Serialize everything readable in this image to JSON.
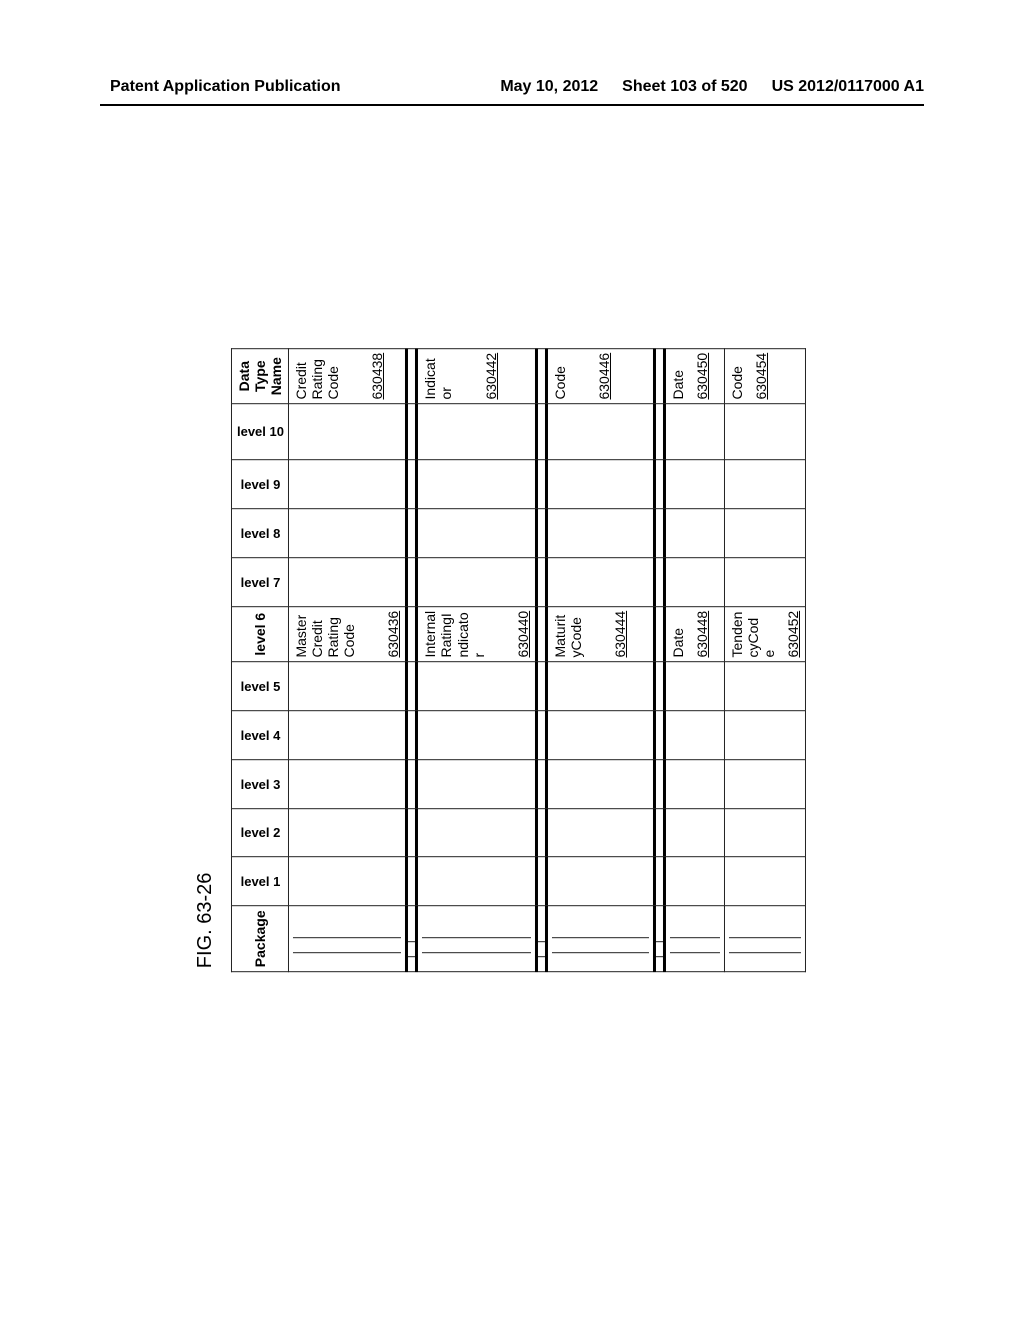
{
  "header": {
    "left": "Patent Application Publication",
    "date": "May 10, 2012",
    "sheet": "Sheet 103 of 520",
    "pubno": "US 2012/0117000 A1"
  },
  "figure_label": "FIG. 63-26",
  "columns": {
    "package": "Package",
    "levels": [
      "level 1",
      "level 2",
      "level 3",
      "level 4",
      "level 5",
      "level 6",
      "level 7",
      "level 8",
      "level 9",
      "level 10"
    ],
    "datatype": "Data Type Name"
  },
  "rows": [
    {
      "size": "big",
      "level6": "MasterCreditRatingCode",
      "level6_ref": "630436",
      "datatype": "CreditRatingCode",
      "datatype_ref": "630438"
    },
    {
      "size": "big",
      "level6": "InternalRatingIndicator",
      "level6_ref": "630440",
      "datatype": "Indicator",
      "datatype_ref": "630442"
    },
    {
      "size": "big",
      "level6": "MaturityCode",
      "level6_ref": "630444",
      "datatype": "Code",
      "datatype_ref": "630446"
    },
    {
      "size": "small",
      "level6": "Date",
      "level6_ref": "630448",
      "datatype": "Date",
      "datatype_ref": "630450"
    },
    {
      "size": "small",
      "level6": "TendencyCode",
      "level6_ref": "630452",
      "datatype": "Code",
      "datatype_ref": "630454"
    }
  ]
}
